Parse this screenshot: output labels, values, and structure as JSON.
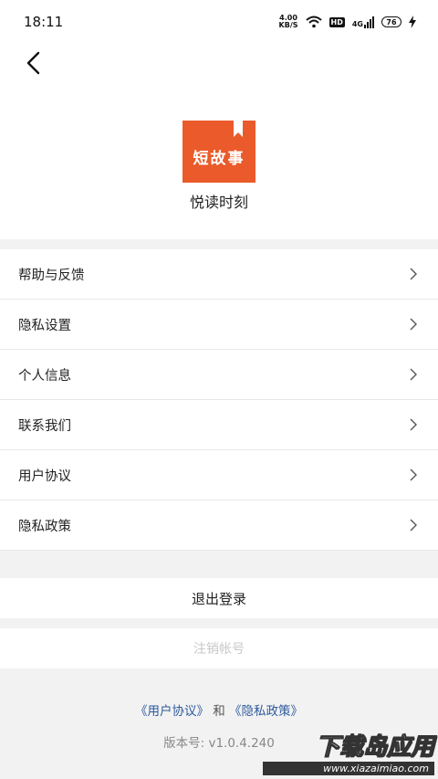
{
  "status_bar": {
    "time": "18:11",
    "net_speed_value": "4.00",
    "net_speed_unit": "KB/S",
    "hd_label": "HD",
    "network_label": "4G",
    "battery_level": "76"
  },
  "app": {
    "logo_text": "短故事",
    "name": "悦读时刻"
  },
  "menu": {
    "items": [
      {
        "label": "帮助与反馈"
      },
      {
        "label": "隐私设置"
      },
      {
        "label": "个人信息"
      },
      {
        "label": "联系我们"
      },
      {
        "label": "用户协议"
      },
      {
        "label": "隐私政策"
      }
    ]
  },
  "actions": {
    "logout_label": "退出登录",
    "cancel_account_label": "注销帐号"
  },
  "footer": {
    "user_agreement_link": "《用户协议》",
    "and_text": "和",
    "privacy_policy_link": "《隐私政策》",
    "version_text": "版本号: v1.0.4.240"
  },
  "watermark": {
    "title": "下载岛应用",
    "url": "www.xiazaimiao.com"
  },
  "colors": {
    "brand_orange": "#ea5a2a",
    "link_blue": "#2f5a9e",
    "page_bg": "#f2f2f2"
  },
  "icons": {
    "back": "chevron-left-icon",
    "row_arrow": "chevron-right-icon"
  }
}
